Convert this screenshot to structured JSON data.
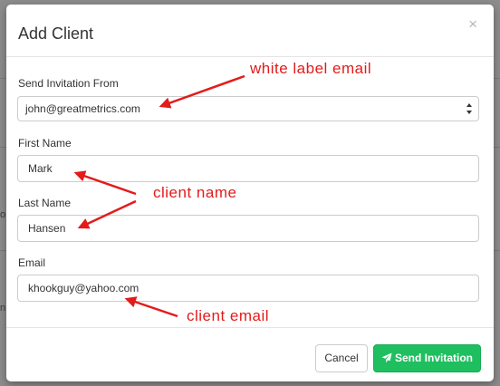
{
  "modal": {
    "title": "Add Client",
    "close_glyph": "×"
  },
  "form": {
    "send_from": {
      "label": "Send Invitation From",
      "value": "john@greatmetrics.com"
    },
    "first_name": {
      "label": "First Name",
      "value": "Mark"
    },
    "last_name": {
      "label": "Last Name",
      "value": "Hansen"
    },
    "email": {
      "label": "Email",
      "value": "khookguy@yahoo.com"
    }
  },
  "footer": {
    "cancel_label": "Cancel",
    "send_label": "Send Invitation",
    "send_icon": "paper-plane-icon"
  },
  "annotations": {
    "white_label": "white label email",
    "client_name": "client name",
    "client_email": "client email"
  },
  "background": {
    "partial_text_1": "o",
    "partial_text_2": "n"
  },
  "colors": {
    "send_button": "#1fbf5f",
    "annotation": "#e31b1b",
    "overlay": "#8c8c8c"
  }
}
